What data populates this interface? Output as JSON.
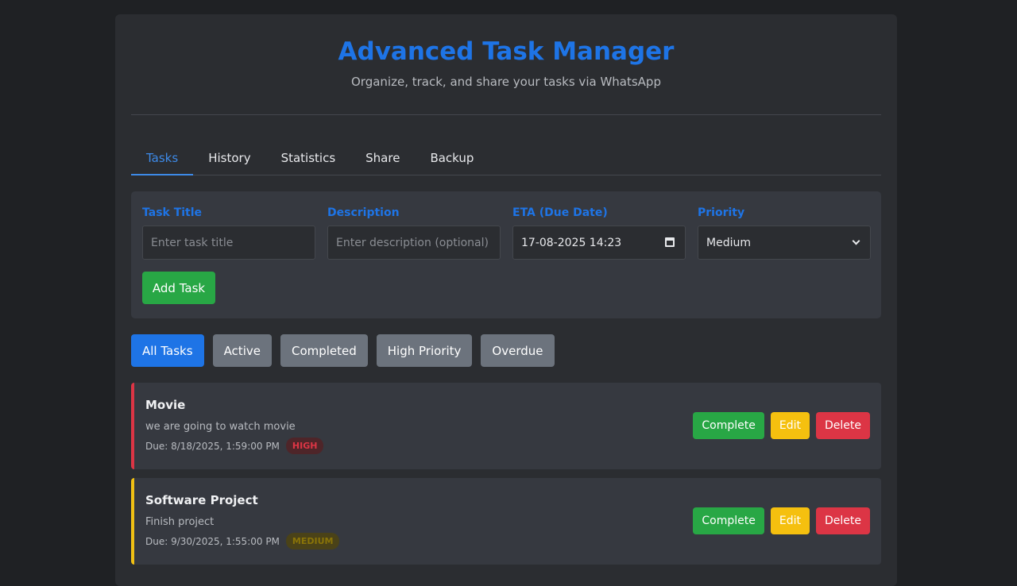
{
  "header": {
    "title": "Advanced Task Manager",
    "subtitle": "Organize, track, and share your tasks via WhatsApp"
  },
  "tabs": [
    {
      "label": "Tasks",
      "active": true
    },
    {
      "label": "History",
      "active": false
    },
    {
      "label": "Statistics",
      "active": false
    },
    {
      "label": "Share",
      "active": false
    },
    {
      "label": "Backup",
      "active": false
    }
  ],
  "form": {
    "title_label": "Task Title",
    "title_placeholder": "Enter task title",
    "desc_label": "Description",
    "desc_placeholder": "Enter description (optional)",
    "eta_label": "ETA (Due Date)",
    "eta_value": "17-08-2025 14:23",
    "priority_label": "Priority",
    "priority_value": "Medium",
    "add_label": "Add Task"
  },
  "filters": [
    {
      "label": "All Tasks",
      "active": true
    },
    {
      "label": "Active",
      "active": false
    },
    {
      "label": "Completed",
      "active": false
    },
    {
      "label": "High Priority",
      "active": false
    },
    {
      "label": "Overdue",
      "active": false
    }
  ],
  "tasks": [
    {
      "title": "Movie",
      "description": "we are going to watch movie",
      "due": "Due: 8/18/2025, 1:59:00 PM",
      "priority": "HIGH",
      "complete_label": "Complete",
      "edit_label": "Edit",
      "delete_label": "Delete"
    },
    {
      "title": "Software Project",
      "description": "Finish project",
      "due": "Due: 9/30/2025, 1:55:00 PM",
      "priority": "MEDIUM",
      "complete_label": "Complete",
      "edit_label": "Edit",
      "delete_label": "Delete"
    }
  ],
  "colors": {
    "accent": "#1e74e6",
    "success": "#28a745",
    "warning": "#f5c00f",
    "danger": "#dc3545"
  }
}
